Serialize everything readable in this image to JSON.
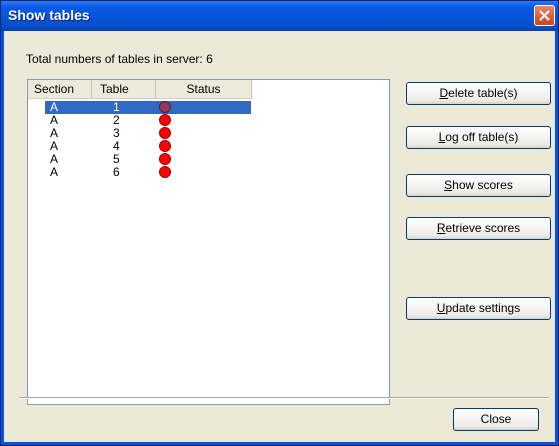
{
  "window": {
    "title": "Show tables"
  },
  "info": {
    "text": "Total numbers of tables in server: 6"
  },
  "listview": {
    "columns": [
      "Section",
      "Table",
      "Status"
    ],
    "rows": [
      {
        "section": "A",
        "table": "1",
        "status": "selected"
      },
      {
        "section": "A",
        "table": "2",
        "status": "red"
      },
      {
        "section": "A",
        "table": "3",
        "status": "red"
      },
      {
        "section": "A",
        "table": "4",
        "status": "red"
      },
      {
        "section": "A",
        "table": "5",
        "status": "red"
      },
      {
        "section": "A",
        "table": "6",
        "status": "red"
      }
    ]
  },
  "buttons": {
    "delete": {
      "mnemonic": "D",
      "rest": "elete table(s)"
    },
    "logoff": {
      "mnemonic": "L",
      "rest": "og off table(s)"
    },
    "show": {
      "mnemonic": "S",
      "rest": "how scores"
    },
    "retrieve": {
      "mnemonic": "R",
      "rest": "etrieve scores"
    },
    "update": {
      "mnemonic": "U",
      "rest": "pdate settings"
    },
    "close": "Close"
  },
  "colors": {
    "status_red": "#ff0000",
    "selection": "#316ac5",
    "titlebar": "#0452d8"
  }
}
